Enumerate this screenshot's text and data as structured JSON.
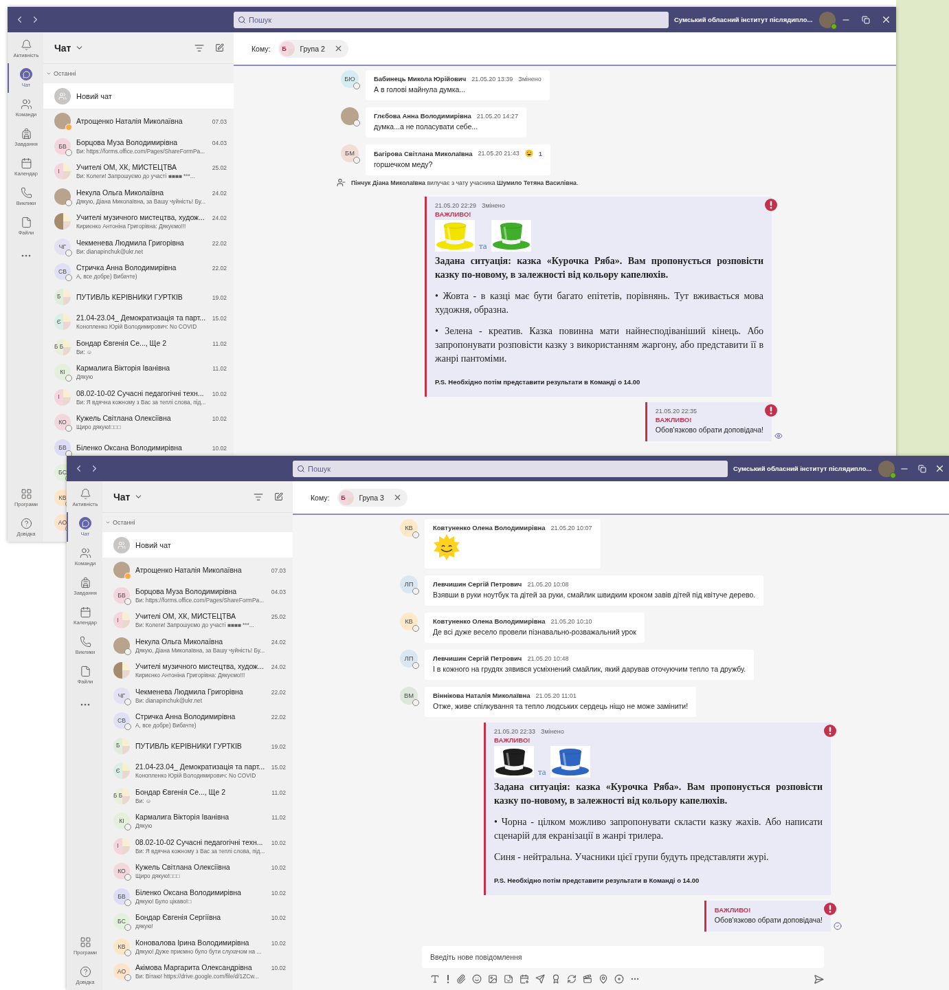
{
  "windows": [
    {
      "search_placeholder": "Пошук",
      "org": "Сумський обласний інститут післядипло...",
      "rail": {
        "items": [
          {
            "kind": "activity",
            "label": "Активність",
            "selected": false
          },
          {
            "kind": "chat",
            "label": "Чат",
            "selected": true
          },
          {
            "kind": "teams",
            "label": "Команди",
            "selected": false
          },
          {
            "kind": "tasks",
            "label": "Завдання",
            "selected": false
          },
          {
            "kind": "calendar",
            "label": "Календар",
            "selected": false
          },
          {
            "kind": "calls",
            "label": "Виклики",
            "selected": false
          },
          {
            "kind": "files",
            "label": "Файли",
            "selected": false
          },
          {
            "kind": "more",
            "selected": false
          }
        ],
        "bottom_items": [
          {
            "kind": "apps",
            "label": "Програми"
          },
          {
            "kind": "help",
            "label": "Довідка"
          }
        ]
      },
      "chat_list": {
        "title": "Чат",
        "section": "Останні",
        "new_chat": "Новий чат",
        "items": [
          {
            "name": "Атрощенко Наталія Миколаївна",
            "date": "07.03",
            "avatar": {
              "kind": "photo"
            },
            "away": true
          },
          {
            "name": "Борцова Муза Володимирівна",
            "date": "04.03",
            "preview": "Ви: https://forms.office.com/Pages/ShareFormPa...",
            "avatar": {
              "kind": "initials",
              "initials": "БВ",
              "color": "#f5d5dd"
            },
            "away": false
          },
          {
            "name": "Учителі ОМ, ХК, МИСТЕЦТВА",
            "date": "25.02",
            "preview": "Ви: Колеги! Запрошуємо до участі ■■■■ ***...",
            "avatar": {
              "kind": "group",
              "initials": "І",
              "color": "#f5d5dd"
            },
            "away": false
          },
          {
            "name": "Некула Ольга Миколаївна",
            "date": "24.02",
            "preview": "Дякую, Діана Миколаївна, за Вашу чуйність! Бу...",
            "avatar": {
              "kind": "photo"
            },
            "away": false
          },
          {
            "name": "Учителі музичного мистецтва, худож...",
            "date": "24.02",
            "preview": "Кириєнко Антоніна Григорівна: Дякуємо!!!",
            "avatar": {
              "kind": "group-photo"
            },
            "away": false
          },
          {
            "name": "Чекменева Людмила Григорівна",
            "date": "22.02",
            "preview": "Ви: dianapinchuk@ukr.net",
            "avatar": {
              "kind": "initials",
              "initials": "ЧГ",
              "color": "#e4e1f4"
            },
            "away": false
          },
          {
            "name": "Стричка Анна Володимирівна",
            "date": "22.02",
            "preview": "А, все добре) Вибачте)",
            "avatar": {
              "kind": "initials",
              "initials": "СВ",
              "color": "#e0e0f5"
            },
            "away": false
          },
          {
            "name": "ПУТИВЛЬ КЕРІВНИКИ ГУРТКІВ",
            "date": "19.02",
            "avatar": {
              "kind": "group",
              "initials": "Б",
              "color": "#dfeedc"
            },
            "away": false
          },
          {
            "name": "21.04-23.04_ Демократизація та парт...",
            "date": "15.02",
            "preview": "Конопленко Юрій Володимирович: No COVID",
            "avatar": {
              "kind": "group",
              "initials": "Є",
              "color": "#d9efe6"
            },
            "away": false
          },
          {
            "name": "Бондар Євгенія Се..., Ще 2",
            "date": "11.02",
            "preview": "Ви: ☺",
            "avatar": {
              "kind": "group",
              "initials": "Б Б",
              "color": "#e8f0dc"
            },
            "away": false
          },
          {
            "name": "Кармалига Вікторія Іванівна",
            "date": "11.02",
            "preview": "Дякую",
            "avatar": {
              "kind": "initials",
              "initials": "КІ",
              "color": "#e5f0dc"
            },
            "away": false
          },
          {
            "name": "08.02-10-02 Сучасні педагогічні техн...",
            "date": "10.02",
            "preview": "Ви: Я вдячна кожному з Вас за теплі слова, під...",
            "avatar": {
              "kind": "group",
              "initials": "І",
              "color": "#f5d5dd"
            },
            "away": false
          },
          {
            "name": "Кужель Світлана Олексіївна",
            "date": "10.02",
            "preview": "Щиро дякую!□□□",
            "avatar": {
              "kind": "initials",
              "initials": "КО",
              "color": "#f2d8dc"
            },
            "away": false
          },
          {
            "name": "Біленко Оксана Володимирівна",
            "date": "10.02",
            "avatar": {
              "kind": "initials",
              "initials": "БВ",
              "color": "#dcdcf4"
            },
            "away": false
          },
          {
            "avatar": {
              "kind": "initials",
              "initials": "БС",
              "color": "#e3f0dc"
            },
            "away": false
          },
          {
            "avatar": {
              "kind": "initials",
              "initials": "КВ",
              "color": "#fde6c6"
            },
            "away": false
          },
          {
            "avatar": {
              "kind": "initials",
              "initials": "АО",
              "color": "#fde2cc"
            },
            "away": false
          }
        ]
      },
      "conversation": {
        "to_label": "Кому:",
        "recipient": {
          "initial": "Б",
          "name": "Група 2"
        },
        "messages": [
          {
            "kind": "incoming",
            "avatar": {
              "kind": "initials",
              "initials": "БЮ",
              "color": "#d5ecf3"
            },
            "sender": "Бабинець Микола Юрійович",
            "time": "21.05.20 13:39",
            "edited": "Змінено",
            "text": "А в голові майнула думка..."
          },
          {
            "kind": "incoming",
            "avatar": {
              "kind": "photo"
            },
            "sender": "Глєбова Анна Володимирівна",
            "time": "21.05.20 14:27",
            "text": "думка...а не поласувати себе..."
          },
          {
            "kind": "incoming",
            "avatar": {
              "kind": "initials",
              "initials": "БМ",
              "color": "#f1ddd6"
            },
            "sender": "Багірова Світлана Миколаївна",
            "time": "21.05.20 21:43",
            "reaction_count": "1",
            "text": "горшечком меду?"
          },
          {
            "kind": "system",
            "text": "**Пінчук Діана Миколаївна** вилучає з чату учасника **Шумило Тетяна Василівна**."
          },
          {
            "kind": "outgoing",
            "time": "21.05.20 22:29",
            "edited": "Змінено",
            "label": "ВАЖЛИВО!",
            "hats": [
              {
                "color": "#f2e400"
              },
              {
                "color": "#3fae2a"
              }
            ],
            "joiner": "та",
            "paragraphs": [
              {
                "kind": "bold",
                "text": "Задана ситуація: казка «Курочка Ряба». Вам пропонується розповісти казку по-новому, в залежності від кольору капелюхів."
              },
              {
                "kind": "plain",
                "text": "• Жовта - в казці має бути багато епітетів, порівнянь. Тут вживається мова художня, образна."
              },
              {
                "kind": "plain",
                "text": "• Зелена - креатив. Казка повинна мати найнесподіваніший кінець. Або запропонувати розповісти казку з використанням жаргону, або представити її в жанрі пантоміми."
              },
              {
                "kind": "note",
                "text": "P.S. Необхідно потім представити результати в Команді о 14.00"
              }
            ]
          },
          {
            "kind": "outgoing",
            "time": "21.05.20 22:35",
            "label": "ВАЖЛИВО!",
            "seen": true,
            "paragraphs": [
              {
                "kind": "body",
                "text": "Обов'язково обрати доповідача!"
              }
            ]
          }
        ]
      }
    },
    {
      "search_placeholder": "Пошук",
      "org": "Сумський обласний інститут післядипло...",
      "rail": {
        "items": [
          {
            "kind": "activity",
            "label": "Активність",
            "selected": false
          },
          {
            "kind": "chat",
            "label": "Чат",
            "selected": true
          },
          {
            "kind": "teams",
            "label": "Команди",
            "selected": false
          },
          {
            "kind": "tasks",
            "label": "Завдання",
            "selected": false
          },
          {
            "kind": "calendar",
            "label": "Календар",
            "selected": false
          },
          {
            "kind": "calls",
            "label": "Виклики",
            "selected": false
          },
          {
            "kind": "files",
            "label": "Файли",
            "selected": false
          },
          {
            "kind": "more",
            "selected": false
          }
        ],
        "bottom_items": [
          {
            "kind": "apps",
            "label": "Програми"
          },
          {
            "kind": "help",
            "label": "Довідка"
          }
        ]
      },
      "chat_list": {
        "title": "Чат",
        "section": "Останні",
        "new_chat": "Новий чат",
        "items": [
          {
            "name": "Атрощенко Наталія Миколаївна",
            "date": "07.03",
            "avatar": {
              "kind": "photo"
            },
            "away": true
          },
          {
            "name": "Борцова Муза Володимирівна",
            "date": "04.03",
            "preview": "Ви: https://forms.office.com/Pages/ShareFormPa...",
            "avatar": {
              "kind": "initials",
              "initials": "БВ",
              "color": "#f5d5dd"
            },
            "away": false
          },
          {
            "name": "Учителі ОМ, ХК, МИСТЕЦТВА",
            "date": "25.02",
            "preview": "Ви: Колеги! Запрошуємо до участі ■■■■ ***...",
            "avatar": {
              "kind": "group",
              "initials": "І",
              "color": "#f5d5dd"
            },
            "away": false
          },
          {
            "name": "Некула Ольга Миколаївна",
            "date": "24.02",
            "preview": "Дякую, Діана Миколаївна, за Вашу чуйність! Бу...",
            "avatar": {
              "kind": "photo"
            },
            "away": false
          },
          {
            "name": "Учителі музичного мистецтва, худож...",
            "date": "24.02",
            "preview": "Кириєнко Антоніна Григорівна: Дякуємо!!!",
            "avatar": {
              "kind": "group-photo"
            },
            "away": false
          },
          {
            "name": "Чекменева Людмила Григорівна",
            "date": "22.02",
            "preview": "Ви: dianapinchuk@ukr.net",
            "avatar": {
              "kind": "initials",
              "initials": "ЧГ",
              "color": "#e4e1f4"
            },
            "away": false
          },
          {
            "name": "Стричка Анна Володимирівна",
            "date": "22.02",
            "preview": "А, все добре) Вибачте)",
            "avatar": {
              "kind": "initials",
              "initials": "СВ",
              "color": "#e0e0f5"
            },
            "away": false
          },
          {
            "name": "ПУТИВЛЬ КЕРІВНИКИ ГУРТКІВ",
            "date": "19.02",
            "avatar": {
              "kind": "group",
              "initials": "Б",
              "color": "#dfeedc"
            },
            "away": false
          },
          {
            "name": "21.04-23.04_ Демократизація та парт...",
            "date": "15.02",
            "preview": "Конопленко Юрій Володимирович: No COVID",
            "avatar": {
              "kind": "group",
              "initials": "Є",
              "color": "#d9efe6"
            },
            "away": false
          },
          {
            "name": "Бондар Євгенія Се..., Ще 2",
            "date": "11.02",
            "preview": "Ви: ☺",
            "avatar": {
              "kind": "group",
              "initials": "Б Б",
              "color": "#e8f0dc"
            },
            "away": false
          },
          {
            "name": "Кармалига Вікторія Іванівна",
            "date": "11.02",
            "preview": "Дякую",
            "avatar": {
              "kind": "initials",
              "initials": "КІ",
              "color": "#e5f0dc"
            },
            "away": false
          },
          {
            "name": "08.02-10-02 Сучасні педагогічні техн...",
            "date": "10.02",
            "preview": "Ви: Я вдячна кожному з Вас за теплі слова, під...",
            "avatar": {
              "kind": "group",
              "initials": "І",
              "color": "#f5d5dd"
            },
            "away": false
          },
          {
            "name": "Кужель Світлана Олексіївна",
            "date": "10.02",
            "preview": "Щиро дякую!□□□",
            "avatar": {
              "kind": "initials",
              "initials": "КО",
              "color": "#f2d8dc"
            },
            "away": false
          },
          {
            "name": "Біленко Оксана Володимирівна",
            "date": "10.02",
            "preview": "Дякую! Було цікаво!□",
            "avatar": {
              "kind": "initials",
              "initials": "БВ",
              "color": "#dcdcf4"
            },
            "away": false
          },
          {
            "name": "Бондар Євгенія Сергіївна",
            "date": "10.02",
            "preview": "дякую!",
            "avatar": {
              "kind": "initials",
              "initials": "БС",
              "color": "#e3f0dc"
            },
            "away": false
          },
          {
            "name": "Коновалова Ірина Володимирівна",
            "date": "10.02",
            "preview": "Дякую! Дуже приємно було бути слухачом на ...",
            "avatar": {
              "kind": "initials",
              "initials": "КВ",
              "color": "#fde6c6"
            },
            "away": false
          },
          {
            "name": "Акімова Маргарита Олександрівна",
            "date": "10.02",
            "preview": "Ви: Вітаю! https://drive.google.com/file/d/1ZCw...",
            "avatar": {
              "kind": "initials",
              "initials": "АО",
              "color": "#fde2cc"
            },
            "away": false
          }
        ]
      },
      "conversation": {
        "to_label": "Кому:",
        "recipient": {
          "initial": "Б",
          "name": "Група 3"
        },
        "messages": [
          {
            "kind": "sticker",
            "avatar": {
              "kind": "initials",
              "initials": "КВ",
              "color": "#fde9c8"
            },
            "sender": "Ковтуненко Олена Володимирівна",
            "time": "21.05.20 10:07"
          },
          {
            "kind": "incoming",
            "avatar": {
              "kind": "initials",
              "initials": "ЛП",
              "color": "#d8e7f2"
            },
            "sender": "Левчишин Сергій Петрович",
            "time": "21.05.20 10:08",
            "text": "Взявши в руки ноутбук та дітей за руки, смайлик швидким кроком завів дітей під квітуче дерево."
          },
          {
            "kind": "incoming",
            "avatar": {
              "kind": "initials",
              "initials": "КВ",
              "color": "#fde9c8"
            },
            "sender": "Ковтуненко Олена Володимирівна",
            "time": "21.05.20 10:10",
            "text": "Де всі дуже весело провели пізнавально-розважальний урок"
          },
          {
            "kind": "incoming",
            "avatar": {
              "kind": "initials",
              "initials": "ЛП",
              "color": "#d8e7f2"
            },
            "sender": "Левчишин Сергій Петрович",
            "time": "21.05.20 10:48",
            "text": "І в кожного на грудях зявився усміхнений смайлик, який дарував оточуючим тепло та дружбу."
          },
          {
            "kind": "incoming",
            "avatar": {
              "kind": "initials",
              "initials": "ВМ",
              "color": "#dfe7dc"
            },
            "sender": "Віннікова Наталія Миколаївна",
            "time": "21.05.20 11:01",
            "text": "Отже, живе спілкування та тепло людських сердець ніщо не може замінити!"
          },
          {
            "kind": "outgoing",
            "time": "21.05.20 22:33",
            "edited": "Змінено",
            "label": "ВАЖЛИВО!",
            "hats": [
              {
                "color": "#1e1e1e"
              },
              {
                "color": "#2f66c4"
              }
            ],
            "joiner": "та",
            "paragraphs": [
              {
                "kind": "bold",
                "text": "Задана ситуація: казка «Курочка Ряба». Вам пропонується розповісти казку по-новому, в залежності від кольору капелюхів."
              },
              {
                "kind": "plain",
                "text": "• Чорна - цілком можливо запропонувати скласти казку жахів. Або написати сценарій для екранізації в жанрі трилера."
              },
              {
                "kind": "plain",
                "text": "Синя - нейтральна. Учасники цієї групи будуть представляти журі."
              },
              {
                "kind": "note",
                "text": "P.S. Необхідно потім представити результати в Команді о 14.00"
              }
            ]
          },
          {
            "kind": "outgoing",
            "label": "ВАЖЛИВО!",
            "seen": false,
            "paragraphs": [
              {
                "kind": "body",
                "text": "Обов'язково обрати доповідача!"
              }
            ]
          }
        ],
        "compose": {
          "placeholder": "Введіть нове повідомлення"
        }
      }
    }
  ]
}
